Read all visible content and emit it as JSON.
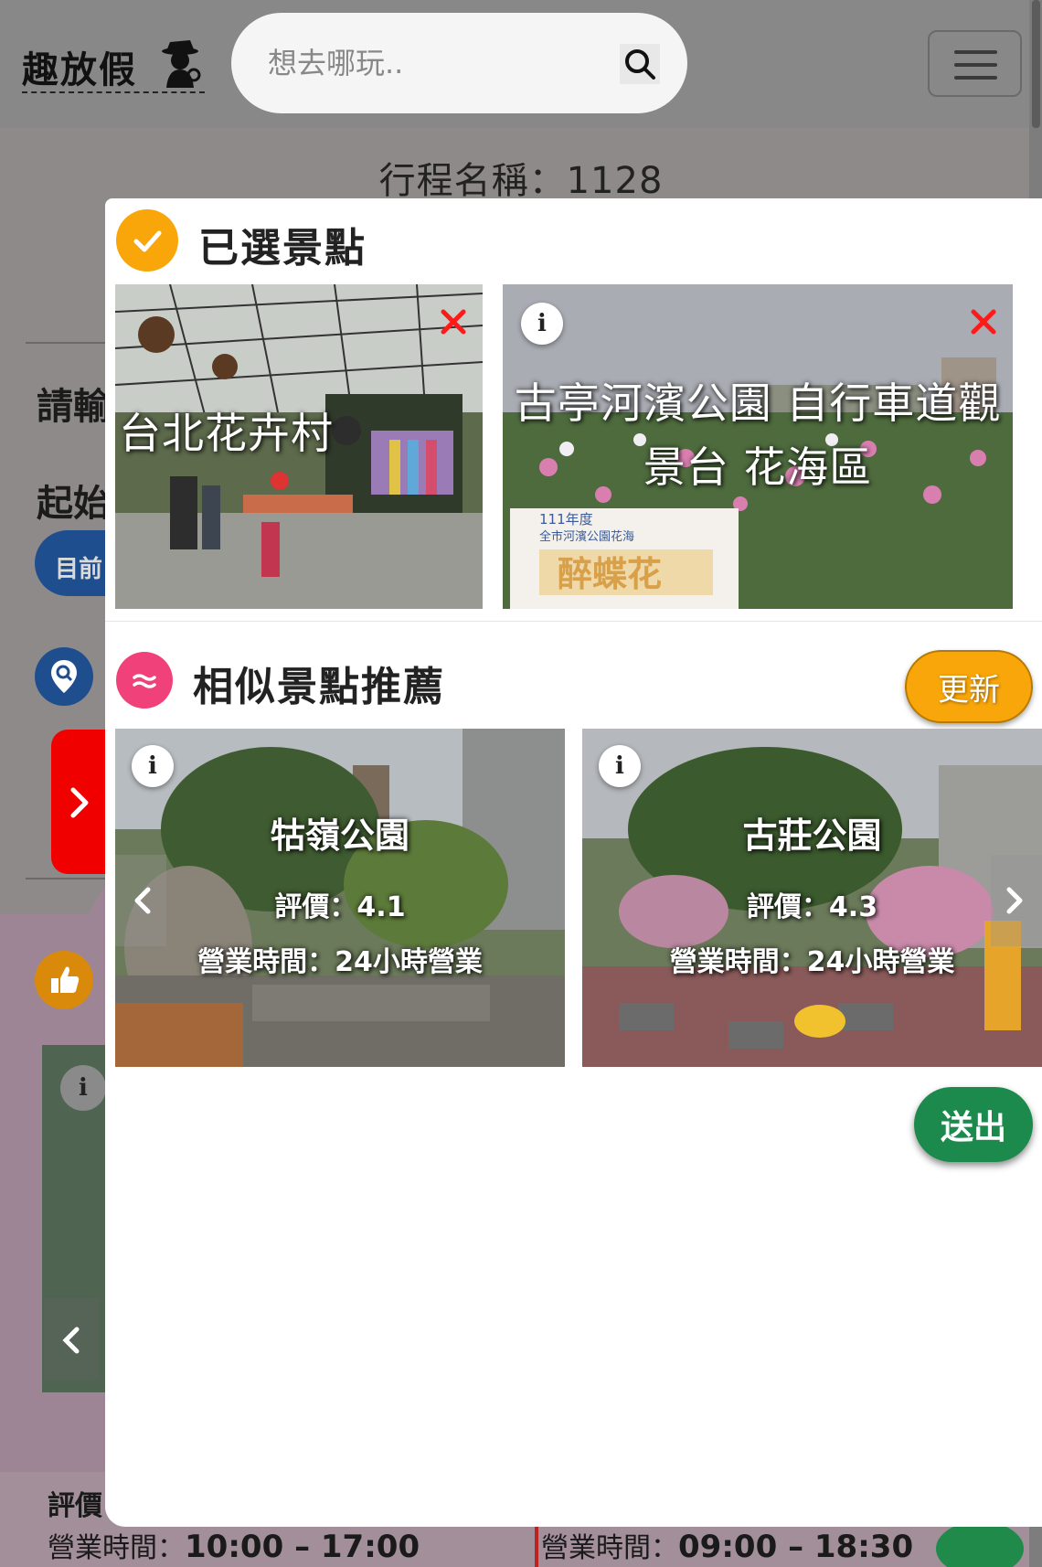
{
  "header": {
    "logo_text": "趣放假",
    "search_placeholder": "想去哪玩..",
    "search_icon": "search-icon",
    "menu_icon": "hamburger-icon"
  },
  "background_page": {
    "trip_title": "行程名稱：1128",
    "label_prompt": "請輸",
    "label_start": "起始",
    "current_location_button": "目前",
    "rating_partial": "評價",
    "hours_left": {
      "label": "營業時間：",
      "value": "10:00 – 17:00"
    },
    "hours_right": {
      "label": "營業時間：",
      "value": "09:00 – 18:30"
    },
    "icons": [
      "map-search-icon",
      "thumbs-up-icon",
      "chevron-right-icon",
      "chevron-left-icon",
      "info-icon"
    ]
  },
  "modal": {
    "selected_section": {
      "title": "已選景點",
      "icon": "check-icon",
      "spots": [
        {
          "name": "台北花卉村",
          "remove_icon": "close-icon"
        },
        {
          "name": "古亭河濱公園 自行車道觀景台 花海區",
          "remove_icon": "close-icon",
          "info_icon": "info-icon",
          "photo_sign": "111年度 全市河濱公園花海 醉蝶花"
        }
      ]
    },
    "recommend_section": {
      "title": "相似景點推薦",
      "icon": "wave-icon",
      "update_label": "更新",
      "places": [
        {
          "name": "牯嶺公園",
          "rating": "評價：4.1",
          "hours": "營業時間：24小時營業",
          "info_icon": "info-icon"
        },
        {
          "name": "古莊公園",
          "rating": "評價：4.3",
          "hours": "營業時間：24小時營業",
          "info_icon": "info-icon"
        }
      ],
      "prev_icon": "chevron-left-icon",
      "next_icon": "chevron-right-icon"
    },
    "submit_label": "送出"
  },
  "colors": {
    "overlay": "#8e8a89",
    "accent_orange": "#f9a60a",
    "accent_pink": "#f0417a",
    "submit_green": "#1d8a4d",
    "nav_blue": "#1f4e8f",
    "remove_red": "#ff1a1a",
    "side_tab_red": "#f10000"
  }
}
